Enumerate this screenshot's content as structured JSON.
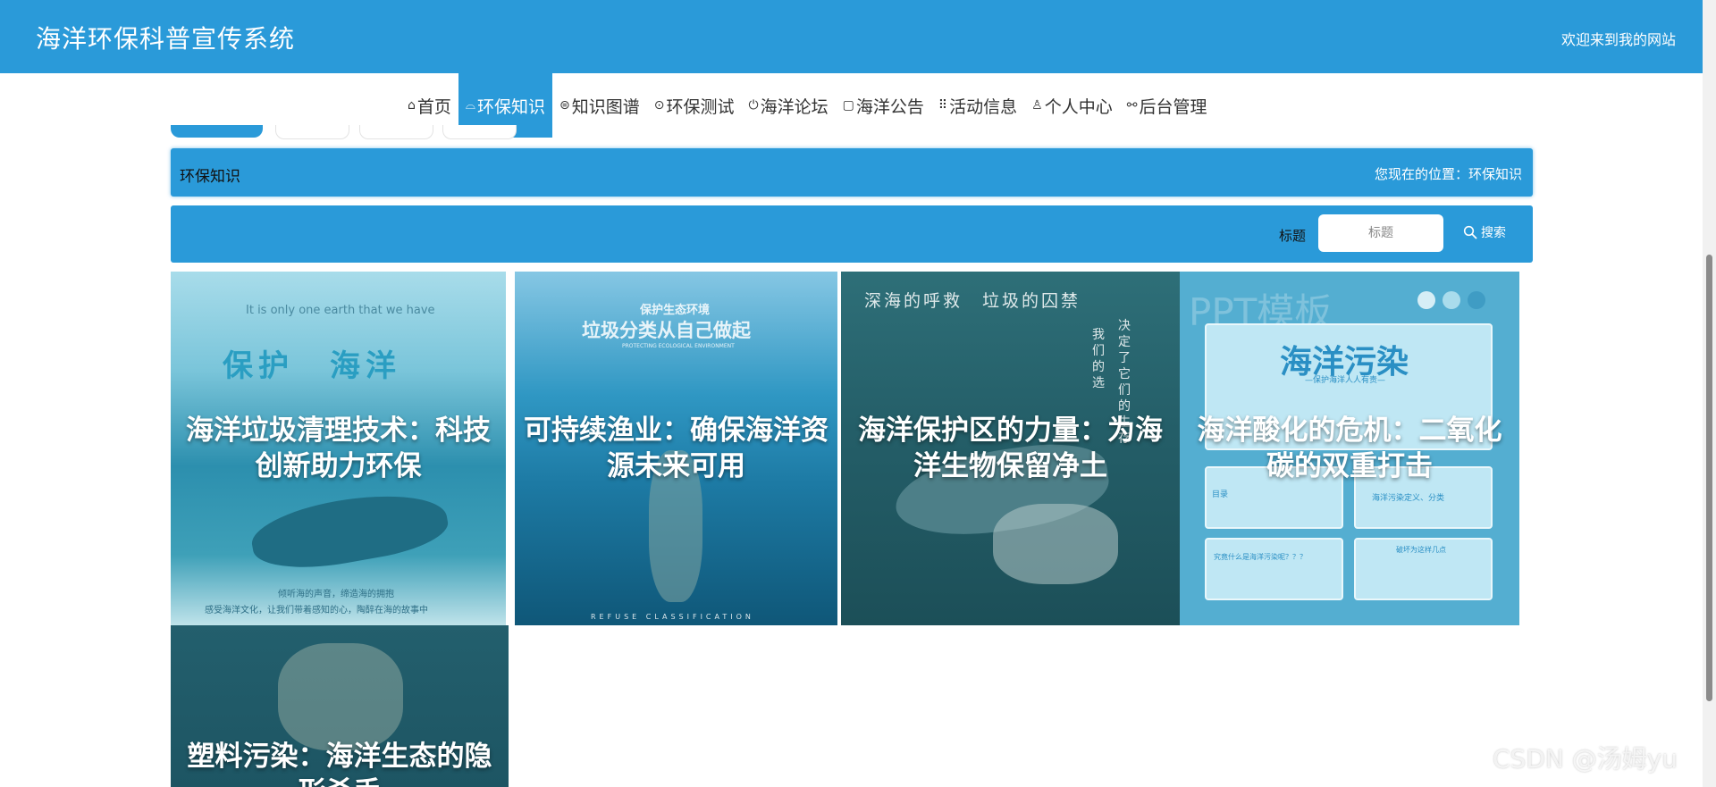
{
  "header": {
    "site_title": "海洋环保科普宣传系统",
    "welcome": "欢迎来到我的网站",
    "bg_color": "#2a9ad9"
  },
  "nav": {
    "items": [
      {
        "label": "首页",
        "icon": "home-icon",
        "glyph": "⌂"
      },
      {
        "label": "环保知识",
        "icon": "leaf-icon",
        "glyph": "⌓"
      },
      {
        "label": "知识图谱",
        "icon": "network-icon",
        "glyph": "⊜"
      },
      {
        "label": "环保测试",
        "icon": "cube-icon",
        "glyph": "⊙"
      },
      {
        "label": "海洋论坛",
        "icon": "power-icon",
        "glyph": "⏻"
      },
      {
        "label": "海洋公告",
        "icon": "document-icon",
        "glyph": "▢"
      },
      {
        "label": "活动信息",
        "icon": "apps-icon",
        "glyph": "⠿"
      },
      {
        "label": "个人中心",
        "icon": "user-icon",
        "glyph": "♙"
      },
      {
        "label": "后台管理",
        "icon": "link-icon",
        "glyph": "⚯"
      }
    ],
    "active_index": 1
  },
  "breadcrumb": {
    "title": "环保知识",
    "location": "您现在的位置：环保知识"
  },
  "search": {
    "label": "标题",
    "placeholder": "标题",
    "button_label": "搜索"
  },
  "cards": [
    {
      "title": "海洋垃圾清理技术：科技创新助力环保",
      "image_text_top": "It is only one earth that we have",
      "image_text_banner": "保护　海洋",
      "image_text_bottom1": "倾听海的声音，缔造海的拥抱",
      "image_text_bottom2": "感受海洋文化，让我们带着感知的心，陶醉在海的故事中"
    },
    {
      "title": "可持续渔业：确保海洋资源未来可用",
      "image_text_top1": "保护生态环境",
      "image_text_top2": "垃圾分类从自己做起",
      "image_text_top3": "PROTECTING ECOLOGICAL ENVIRONMENT",
      "image_text_bottom": "REFUSE CLASSIFICATION"
    },
    {
      "title": "海洋保护区的力量：为海洋生物保留净土",
      "image_text_top": "深海的呼救　垃圾的囚禁",
      "image_text_vertical1": "我们的选",
      "image_text_vertical2": "决定了它们的生存"
    },
    {
      "title": "海洋酸化的危机：二氧化碳的双重打击",
      "image_text_bg": "PPT模板",
      "image_text_slide": "海洋污染",
      "image_text_slide_sub": "—保护海洋人人有责—",
      "image_text_mini1": "海洋污染定义、分类",
      "image_text_mini2": "目录",
      "image_text_mini3": "究竟什么是海洋污染呢？？？",
      "image_text_mini4": "破坏为这样几点"
    },
    {
      "title": "塑料污染：海洋生态的隐形杀手"
    }
  ],
  "watermark": "CSDN @汤姆yu"
}
